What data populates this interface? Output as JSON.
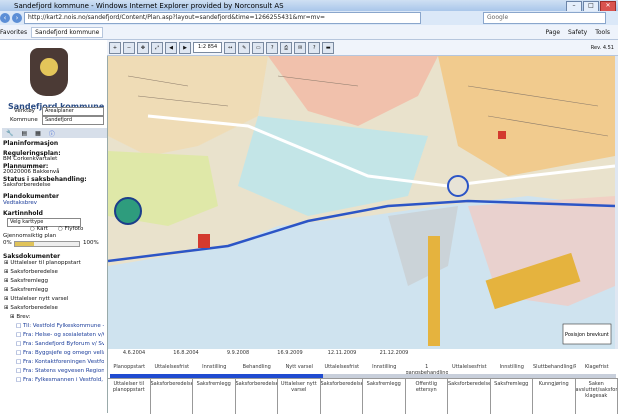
{
  "window": {
    "title": "Sandefjord kommune - Windows Internet Explorer provided by Norconsult AS"
  },
  "browser": {
    "url": "http://kart2.nois.no/sandefjord/Content/Plan.asp?layout=sandefjord&time=1266255431&mr=mv=",
    "search_placeholder": "Google",
    "favorites_label": "Favorites",
    "tab_title": "Sandefjord kommune",
    "menus": [
      "Page",
      "Safety",
      "Tools"
    ]
  },
  "left": {
    "municipality": "Sandefjord kommune",
    "verktoy_label": "Verktøy",
    "verktoy_value": "Arealplaner",
    "kommune_label": "Kommune",
    "kommune_value": "Sandefjord",
    "plan_title": "Planinformasjon",
    "regplan_label": "Reguleringsplan:",
    "regplan_value": "BM Corkenkvartalet",
    "plannr_label": "Plannummer:",
    "plannr_value": "20020006   Bakkenvå",
    "status_label": "Status i saksbehandling:",
    "status_value": "Saksforberedelse",
    "plandok_title": "Plandokumenter",
    "plandok_link": "Vedtaksbrev",
    "kart_title": "Kartinnhold",
    "kart_select": "Velg karttype",
    "radio1": "Kart",
    "radio2": "Flyfoto",
    "gjen_label": "Gjennomsiktig plan",
    "pct_start": "0%",
    "pct_end": "100%",
    "transparency_percent": 30,
    "sak_title": "Saksdokumenter",
    "tree": [
      "Uttalelser til planoppstart",
      "Saksforberedelse",
      "Saksfremlegg",
      "Saksfremlegg",
      "Uttalelser nytt varsel",
      "Saksforberedelse",
      "Brev:",
      "Til: Vestfold Fylkeskommune - Fylkesadministrasjonen",
      "Fra: Helse- og sosialetaten v/Gerd Solli",
      "Fra: Sandefjord Byforum v/ Sven Erik Lund",
      "Fra: Byggsjefe og omegn vellag",
      "Fra: Kontaktforeningen Vestfold avdeling",
      "Fra: Statens vegvesen Region sør",
      "Fra: Fylkesmannen i Vestfold, Miljøvernavd."
    ]
  },
  "toolbar": {
    "scale": "1:2 854",
    "right_label": "Rev. 4.51"
  },
  "timeline": {
    "dates": [
      "4.6.2004",
      "16.8.2004",
      "9.9.2008",
      "16.9.2009",
      "12.11.2009",
      "21.12.2009"
    ],
    "stage_labels": [
      "Planoppstart",
      "Uttalelsesfrist",
      "Innstilling",
      "Behandling",
      "Nytt varsel",
      "Uttalelsesfrist",
      "Innstilling",
      "1 gangsbehandling",
      "Uttalelsesfrist",
      "Innstilling",
      "Sluttbehandling/Planvedtak",
      "Klagefrist"
    ],
    "progress_fraction": 0.42,
    "stages": [
      "Uttalelser til planoppstart",
      "Saksforberedelse",
      "Saksfremlegg",
      "Saksforberedelse",
      "Uttalelser nytt varsel",
      "Saksforberedelse",
      "Saksfremlegg",
      "Offentlig ettersyn",
      "Saksforberedelse",
      "Saksfremlegg",
      "Kunngjøring",
      "Saken avsluttet/saksforberedelse klagesak"
    ],
    "map_label": "Posisjon brevkunt"
  }
}
